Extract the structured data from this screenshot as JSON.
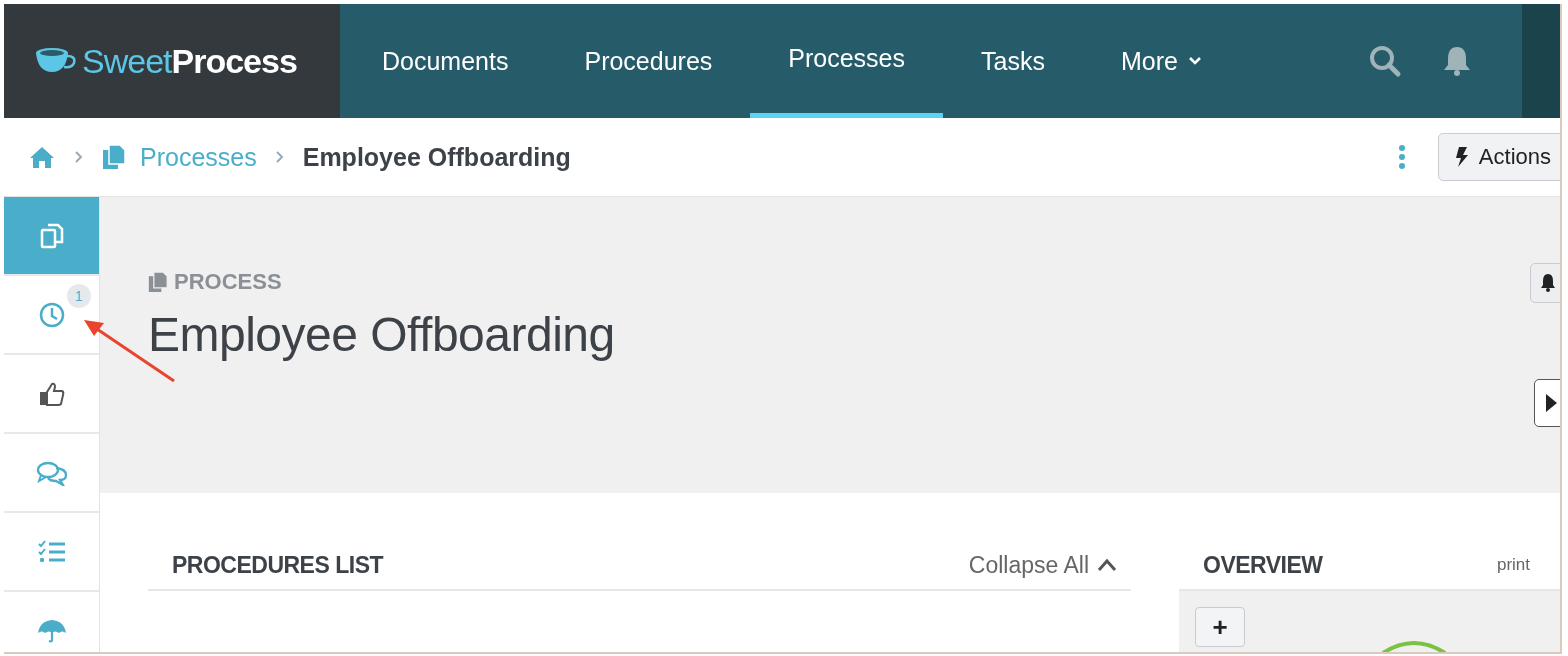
{
  "logo": {
    "light": "Sweet",
    "bold": "Process"
  },
  "nav": [
    {
      "label": "Documents",
      "selected": false
    },
    {
      "label": "Procedures",
      "selected": false
    },
    {
      "label": "Processes",
      "selected": true
    },
    {
      "label": "Tasks",
      "selected": false
    },
    {
      "label": "More",
      "selected": false,
      "dropdown": true
    }
  ],
  "breadcrumb": {
    "parent": "Processes",
    "current": "Employee Offboarding"
  },
  "actions_button": "Actions",
  "sidebar": [
    {
      "selected": true
    },
    {
      "selected": false,
      "badge": "1"
    },
    {
      "selected": false
    },
    {
      "selected": false
    },
    {
      "selected": false
    },
    {
      "selected": false
    }
  ],
  "header": {
    "eyebrow": "PROCESS",
    "title": "Employee Offboarding"
  },
  "procedures_list": {
    "title": "PROCEDURES LIST",
    "collapse": "Collapse All"
  },
  "overview": {
    "title": "OVERVIEW",
    "print": "print",
    "add_button": "+"
  }
}
